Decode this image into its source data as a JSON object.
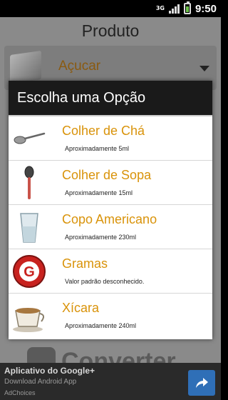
{
  "status": {
    "network": "3G",
    "time": "9:50"
  },
  "app": {
    "title": "Produto",
    "selected_product": "Açucar",
    "convert_label": "Converter"
  },
  "dialog": {
    "title": "Escolha uma Opção",
    "options": [
      {
        "label": "Colher de Chá",
        "desc": "Aproximadamente 5ml",
        "icon": "teaspoon-icon"
      },
      {
        "label": "Colher de Sopa",
        "desc": "Aproximadamente 15ml",
        "icon": "tablespoon-icon"
      },
      {
        "label": "Copo Americano",
        "desc": "Aproximadamente 230ml",
        "icon": "glass-icon"
      },
      {
        "label": "Gramas",
        "desc": "Valor padrão desconhecido.",
        "icon": "grams-icon"
      },
      {
        "label": "Xícara",
        "desc": "Aproximadamente 240ml",
        "icon": "cup-icon"
      }
    ]
  },
  "ad": {
    "title": "Aplicativo do Google+",
    "subtitle": "Download Android App",
    "choices": "AdChoices"
  },
  "colors": {
    "accent": "#d9930a",
    "dialog_header": "#1a1a1a",
    "ad_button": "#2f6fb7"
  }
}
